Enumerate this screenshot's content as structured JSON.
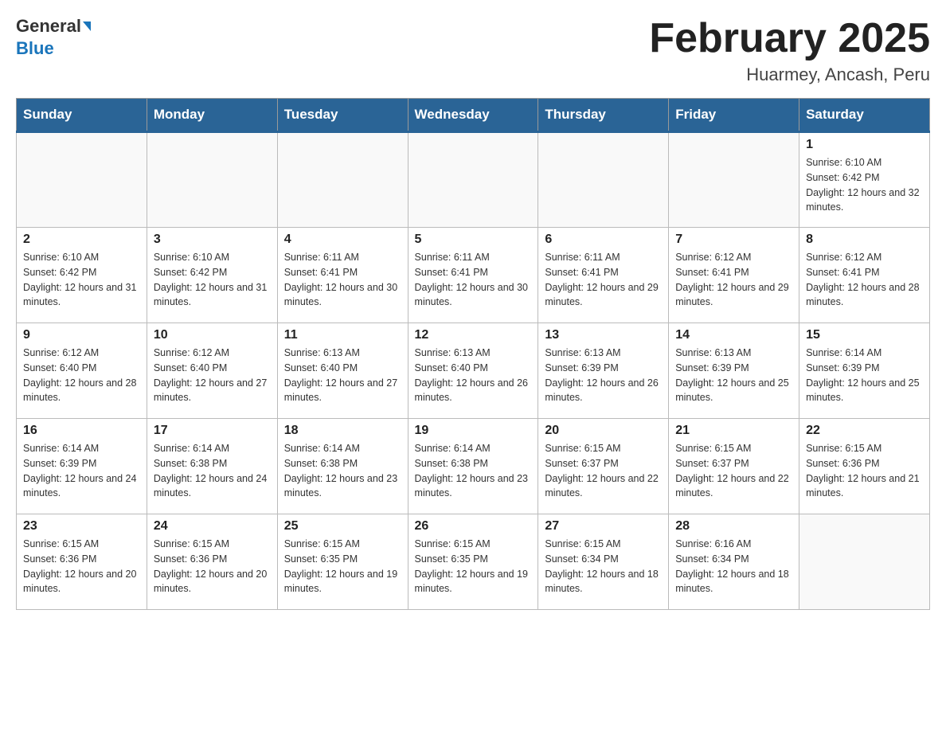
{
  "header": {
    "logo_line1": "General",
    "logo_line2": "Blue",
    "month_title": "February 2025",
    "location": "Huarmey, Ancash, Peru"
  },
  "days_of_week": [
    "Sunday",
    "Monday",
    "Tuesday",
    "Wednesday",
    "Thursday",
    "Friday",
    "Saturday"
  ],
  "weeks": [
    [
      {
        "day": "",
        "info": ""
      },
      {
        "day": "",
        "info": ""
      },
      {
        "day": "",
        "info": ""
      },
      {
        "day": "",
        "info": ""
      },
      {
        "day": "",
        "info": ""
      },
      {
        "day": "",
        "info": ""
      },
      {
        "day": "1",
        "info": "Sunrise: 6:10 AM\nSunset: 6:42 PM\nDaylight: 12 hours and 32 minutes."
      }
    ],
    [
      {
        "day": "2",
        "info": "Sunrise: 6:10 AM\nSunset: 6:42 PM\nDaylight: 12 hours and 31 minutes."
      },
      {
        "day": "3",
        "info": "Sunrise: 6:10 AM\nSunset: 6:42 PM\nDaylight: 12 hours and 31 minutes."
      },
      {
        "day": "4",
        "info": "Sunrise: 6:11 AM\nSunset: 6:41 PM\nDaylight: 12 hours and 30 minutes."
      },
      {
        "day": "5",
        "info": "Sunrise: 6:11 AM\nSunset: 6:41 PM\nDaylight: 12 hours and 30 minutes."
      },
      {
        "day": "6",
        "info": "Sunrise: 6:11 AM\nSunset: 6:41 PM\nDaylight: 12 hours and 29 minutes."
      },
      {
        "day": "7",
        "info": "Sunrise: 6:12 AM\nSunset: 6:41 PM\nDaylight: 12 hours and 29 minutes."
      },
      {
        "day": "8",
        "info": "Sunrise: 6:12 AM\nSunset: 6:41 PM\nDaylight: 12 hours and 28 minutes."
      }
    ],
    [
      {
        "day": "9",
        "info": "Sunrise: 6:12 AM\nSunset: 6:40 PM\nDaylight: 12 hours and 28 minutes."
      },
      {
        "day": "10",
        "info": "Sunrise: 6:12 AM\nSunset: 6:40 PM\nDaylight: 12 hours and 27 minutes."
      },
      {
        "day": "11",
        "info": "Sunrise: 6:13 AM\nSunset: 6:40 PM\nDaylight: 12 hours and 27 minutes."
      },
      {
        "day": "12",
        "info": "Sunrise: 6:13 AM\nSunset: 6:40 PM\nDaylight: 12 hours and 26 minutes."
      },
      {
        "day": "13",
        "info": "Sunrise: 6:13 AM\nSunset: 6:39 PM\nDaylight: 12 hours and 26 minutes."
      },
      {
        "day": "14",
        "info": "Sunrise: 6:13 AM\nSunset: 6:39 PM\nDaylight: 12 hours and 25 minutes."
      },
      {
        "day": "15",
        "info": "Sunrise: 6:14 AM\nSunset: 6:39 PM\nDaylight: 12 hours and 25 minutes."
      }
    ],
    [
      {
        "day": "16",
        "info": "Sunrise: 6:14 AM\nSunset: 6:39 PM\nDaylight: 12 hours and 24 minutes."
      },
      {
        "day": "17",
        "info": "Sunrise: 6:14 AM\nSunset: 6:38 PM\nDaylight: 12 hours and 24 minutes."
      },
      {
        "day": "18",
        "info": "Sunrise: 6:14 AM\nSunset: 6:38 PM\nDaylight: 12 hours and 23 minutes."
      },
      {
        "day": "19",
        "info": "Sunrise: 6:14 AM\nSunset: 6:38 PM\nDaylight: 12 hours and 23 minutes."
      },
      {
        "day": "20",
        "info": "Sunrise: 6:15 AM\nSunset: 6:37 PM\nDaylight: 12 hours and 22 minutes."
      },
      {
        "day": "21",
        "info": "Sunrise: 6:15 AM\nSunset: 6:37 PM\nDaylight: 12 hours and 22 minutes."
      },
      {
        "day": "22",
        "info": "Sunrise: 6:15 AM\nSunset: 6:36 PM\nDaylight: 12 hours and 21 minutes."
      }
    ],
    [
      {
        "day": "23",
        "info": "Sunrise: 6:15 AM\nSunset: 6:36 PM\nDaylight: 12 hours and 20 minutes."
      },
      {
        "day": "24",
        "info": "Sunrise: 6:15 AM\nSunset: 6:36 PM\nDaylight: 12 hours and 20 minutes."
      },
      {
        "day": "25",
        "info": "Sunrise: 6:15 AM\nSunset: 6:35 PM\nDaylight: 12 hours and 19 minutes."
      },
      {
        "day": "26",
        "info": "Sunrise: 6:15 AM\nSunset: 6:35 PM\nDaylight: 12 hours and 19 minutes."
      },
      {
        "day": "27",
        "info": "Sunrise: 6:15 AM\nSunset: 6:34 PM\nDaylight: 12 hours and 18 minutes."
      },
      {
        "day": "28",
        "info": "Sunrise: 6:16 AM\nSunset: 6:34 PM\nDaylight: 12 hours and 18 minutes."
      },
      {
        "day": "",
        "info": ""
      }
    ]
  ]
}
